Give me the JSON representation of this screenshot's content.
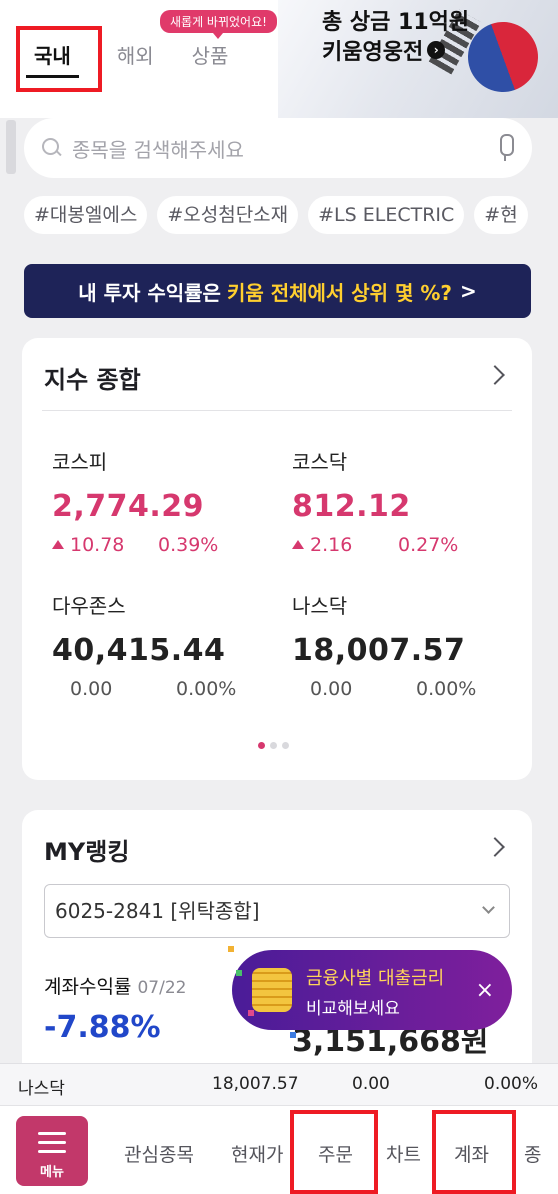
{
  "header": {
    "tabs": [
      "국내",
      "해외",
      "상품"
    ],
    "active_tab": "국내",
    "new_badge": "새롭게 바뀌었어요!",
    "banner_line1": "총 상금 11억원",
    "banner_line2": "키움영웅전"
  },
  "search": {
    "placeholder": "종목을 검색해주세요"
  },
  "chips": [
    "#대봉엘에스",
    "#오성첨단소재",
    "#LS ELECTRIC",
    "#현"
  ],
  "promo": {
    "text": "내 투자 수익률은",
    "highlight": "키움 전체에서 상위 몇 %?",
    "arrow": ">"
  },
  "index_card": {
    "title": "지수 종합",
    "items": [
      {
        "name": "코스피",
        "value": "2,774.29",
        "change": "10.78",
        "rate": "0.39%"
      },
      {
        "name": "코스닥",
        "value": "812.12",
        "change": "2.16",
        "rate": "0.27%"
      },
      {
        "name": "다우존스",
        "value": "40,415.44",
        "change": "0.00",
        "rate": "0.00%"
      },
      {
        "name": "나스닥",
        "value": "18,007.57",
        "change": "0.00",
        "rate": "0.00%"
      }
    ],
    "page_indicator": {
      "current": 1,
      "total": 3
    }
  },
  "rank_card": {
    "title": "MY랭킹",
    "account": "6025-2841 [위탁종합]",
    "rate_label": "계좌수익률",
    "rate_date": "07/22",
    "rate_value": "-7.88%",
    "amount": "3,151,668원"
  },
  "floating": {
    "line1": "금융사별 대출금리",
    "line2": "비교해보세요",
    "close": "×"
  },
  "ticker": {
    "name": "나스닥",
    "value": "18,007.57",
    "change": "0.00",
    "rate": "0.00%"
  },
  "bottom_nav": {
    "menu_label": "메뉴",
    "items": [
      "관심종목",
      "현재가",
      "주문",
      "차트",
      "계좌",
      "종"
    ]
  },
  "colors": {
    "accent": "#d6386e",
    "navy": "#1e2358",
    "blue": "#2147c9",
    "highlight_box": "#ee1b24"
  }
}
